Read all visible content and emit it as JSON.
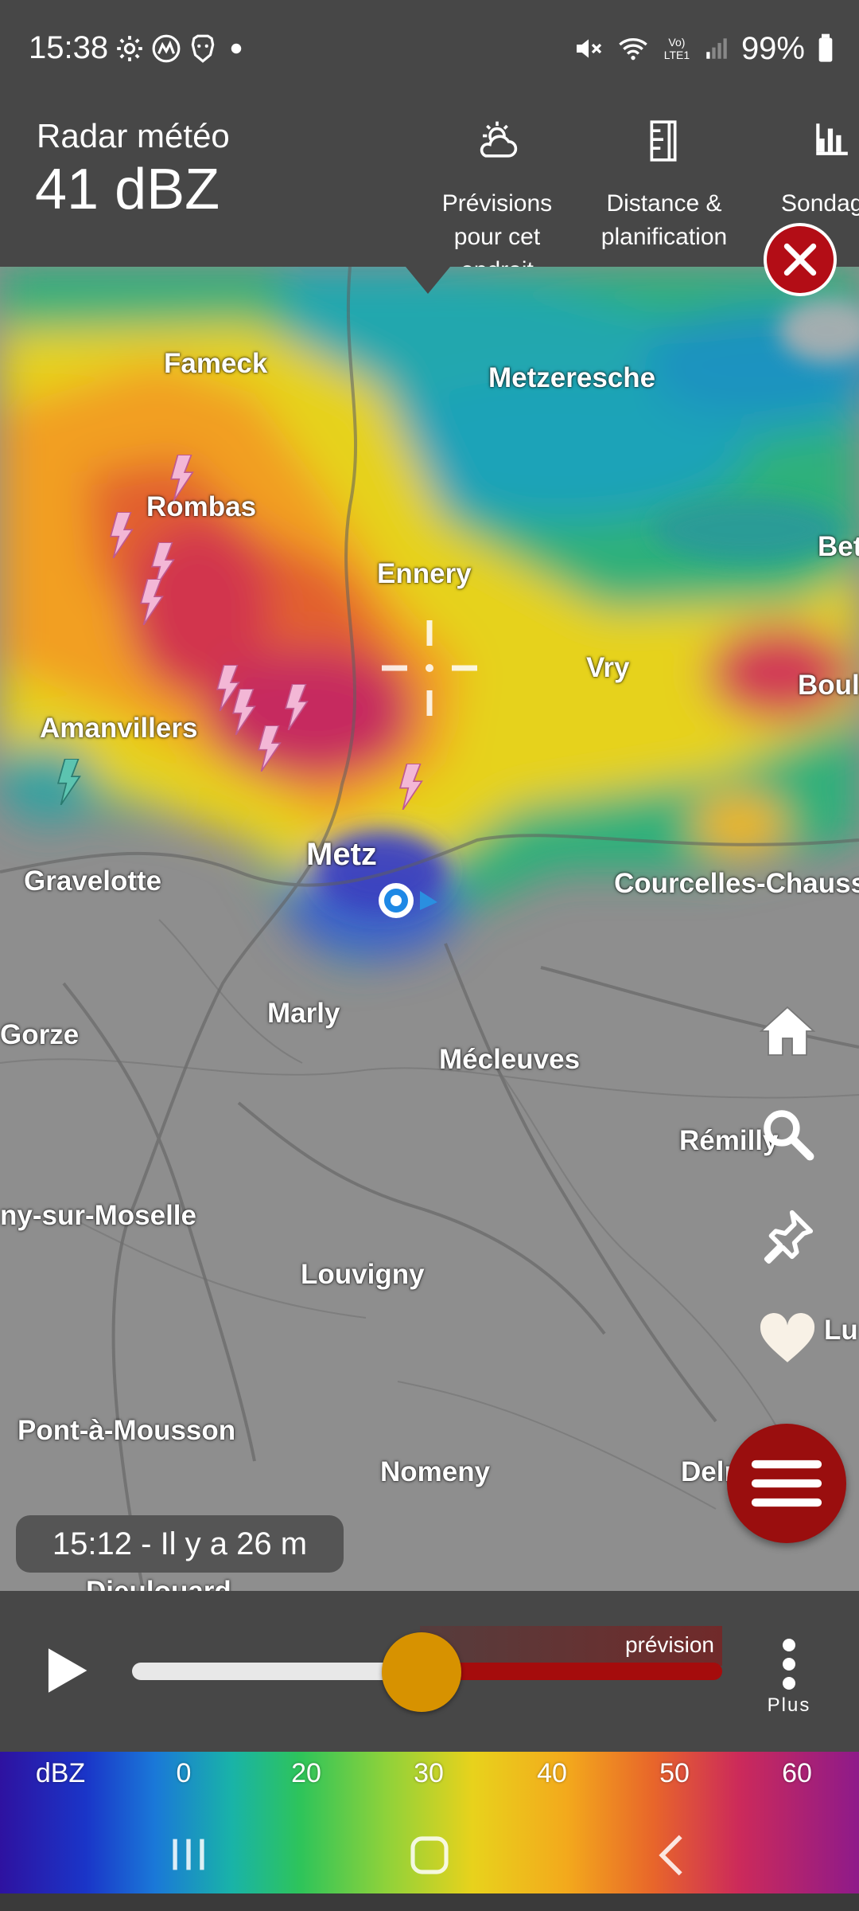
{
  "status_bar": {
    "time": "15:38",
    "left_icons": [
      "settings-gear-icon",
      "market-icon",
      "brave-lion-icon",
      "notification-dot-icon"
    ],
    "right_icons": [
      "mute-icon",
      "wifi-icon",
      "volte-lte-icon",
      "signal-icon",
      "battery-icon"
    ],
    "volte_text": "Vo) LTE1",
    "battery": "99%"
  },
  "header": {
    "title": "Radar météo",
    "value": "41 dBZ",
    "actions": [
      {
        "label": "Prévisions pour cet endroit",
        "icon": "cloud-sun-icon"
      },
      {
        "label": "Distance & planification",
        "icon": "ruler-icon"
      },
      {
        "label": "Sondag",
        "icon": "bar-chart-icon"
      }
    ],
    "action_lines": [
      [
        "Prévisions",
        "pour cet",
        "endroit"
      ],
      [
        "Distance &",
        "planification"
      ],
      [
        "Sondag"
      ]
    ]
  },
  "map": {
    "cities": {
      "fameck": "Fameck",
      "metzeresche": "Metzeresche",
      "rombas": "Rombas",
      "ennery": "Ennery",
      "bet": "Bet",
      "vry": "Vry",
      "boula": "Boula",
      "amanvillers": "Amanvillers",
      "metz": "Metz",
      "gravelotte": "Gravelotte",
      "courcelles": "Courcelles-Chaussy",
      "marly": "Marly",
      "gorze": "Gorze",
      "mecleuves": "Mécleuves",
      "remilly": "Rémilly",
      "moselle": "ny-sur-Moselle",
      "louvigny": "Louvigny",
      "pont": "Pont-à-Mousson",
      "nomeny": "Nomeny",
      "delm": "Delm",
      "lu": "Lu",
      "dieulouard": "Dieulouard"
    },
    "timestamp": "15:12 - Il y a 26 m",
    "side_icons": [
      "home-icon",
      "search-icon",
      "pin-icon",
      "heart-icon"
    ]
  },
  "controls": {
    "forecast_label": "prévision",
    "more_label": "Plus",
    "progress": 0.49
  },
  "legend": {
    "unit": "dBZ",
    "ticks": [
      "0",
      "20",
      "30",
      "40",
      "50",
      "60"
    ]
  },
  "colors": {
    "header_bg": "#474747",
    "accent_red": "#b30d16",
    "slider_thumb": "#d79200"
  }
}
